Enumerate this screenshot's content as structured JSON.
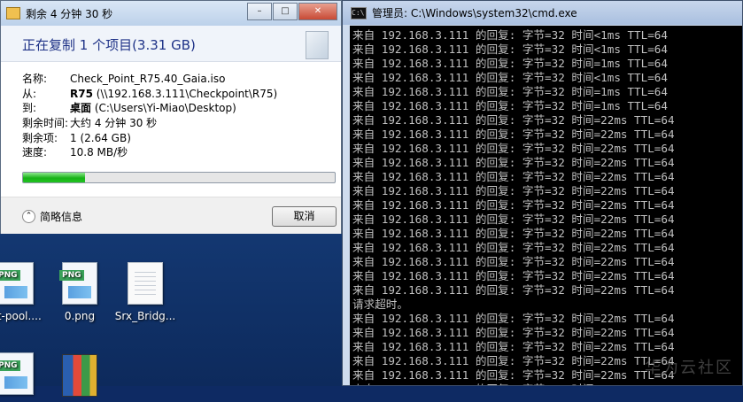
{
  "copy_dialog": {
    "title": "剩余 4 分钟 30 秒",
    "heading": "正在复制 1 个项目(3.31 GB)",
    "rows": [
      {
        "label": "名称:",
        "value": "Check_Point_R75.40_Gaia.iso",
        "bold": ""
      },
      {
        "label": "从:",
        "bold": "R75",
        "value": " (\\\\192.168.3.111\\Checkpoint\\R75)"
      },
      {
        "label": "到:",
        "bold": "桌面",
        "value": " (C:\\Users\\Yi-Miao\\Desktop)"
      },
      {
        "label": "剩余时间:",
        "value": "大约 4 分钟 30 秒",
        "bold": ""
      },
      {
        "label": "剩余项:",
        "value": "1 (2.64 GB)",
        "bold": ""
      },
      {
        "label": "速度:",
        "value": "10.8 MB/秒",
        "bold": ""
      }
    ],
    "progress": 0.2,
    "more_info_label": "简略信息",
    "cancel_label": "取消"
  },
  "desktop_icons": [
    {
      "label": "nt-pool....",
      "type": "png"
    },
    {
      "label": "0.png",
      "type": "png"
    },
    {
      "label": "Srx_Bridg...",
      "type": "txt"
    },
    {
      "label": "",
      "type": "png"
    },
    {
      "label": "",
      "type": "rar"
    }
  ],
  "cmd": {
    "title": "管理员: C:\\Windows\\system32\\cmd.exe",
    "lines": [
      "来自 192.168.3.111 的回复: 字节=32 时间<1ms TTL=64",
      "来自 192.168.3.111 的回复: 字节=32 时间<1ms TTL=64",
      "来自 192.168.3.111 的回复: 字节=32 时间=1ms TTL=64",
      "来自 192.168.3.111 的回复: 字节=32 时间<1ms TTL=64",
      "来自 192.168.3.111 的回复: 字节=32 时间=1ms TTL=64",
      "来自 192.168.3.111 的回复: 字节=32 时间=1ms TTL=64",
      "来自 192.168.3.111 的回复: 字节=32 时间=22ms TTL=64",
      "来自 192.168.3.111 的回复: 字节=32 时间=22ms TTL=64",
      "来自 192.168.3.111 的回复: 字节=32 时间=22ms TTL=64",
      "来自 192.168.3.111 的回复: 字节=32 时间=22ms TTL=64",
      "来自 192.168.3.111 的回复: 字节=32 时间=22ms TTL=64",
      "来自 192.168.3.111 的回复: 字节=32 时间=22ms TTL=64",
      "来自 192.168.3.111 的回复: 字节=32 时间=22ms TTL=64",
      "来自 192.168.3.111 的回复: 字节=32 时间=22ms TTL=64",
      "来自 192.168.3.111 的回复: 字节=32 时间=22ms TTL=64",
      "来自 192.168.3.111 的回复: 字节=32 时间=22ms TTL=64",
      "来自 192.168.3.111 的回复: 字节=32 时间=22ms TTL=64",
      "来自 192.168.3.111 的回复: 字节=32 时间=22ms TTL=64",
      "来自 192.168.3.111 的回复: 字节=32 时间=22ms TTL=64",
      "请求超时。",
      "来自 192.168.3.111 的回复: 字节=32 时间=22ms TTL=64",
      "来自 192.168.3.111 的回复: 字节=32 时间=22ms TTL=64",
      "来自 192.168.3.111 的回复: 字节=32 时间=22ms TTL=64",
      "来自 192.168.3.111 的回复: 字节=32 时间=22ms TTL=64",
      "来自 192.168.3.111 的回复: 字节=32 时间=22ms TTL=64",
      "来自 192.168.3.111 的回复: 字节=32 时间=22ms TTL=64"
    ],
    "watermark": "华为云社区"
  }
}
